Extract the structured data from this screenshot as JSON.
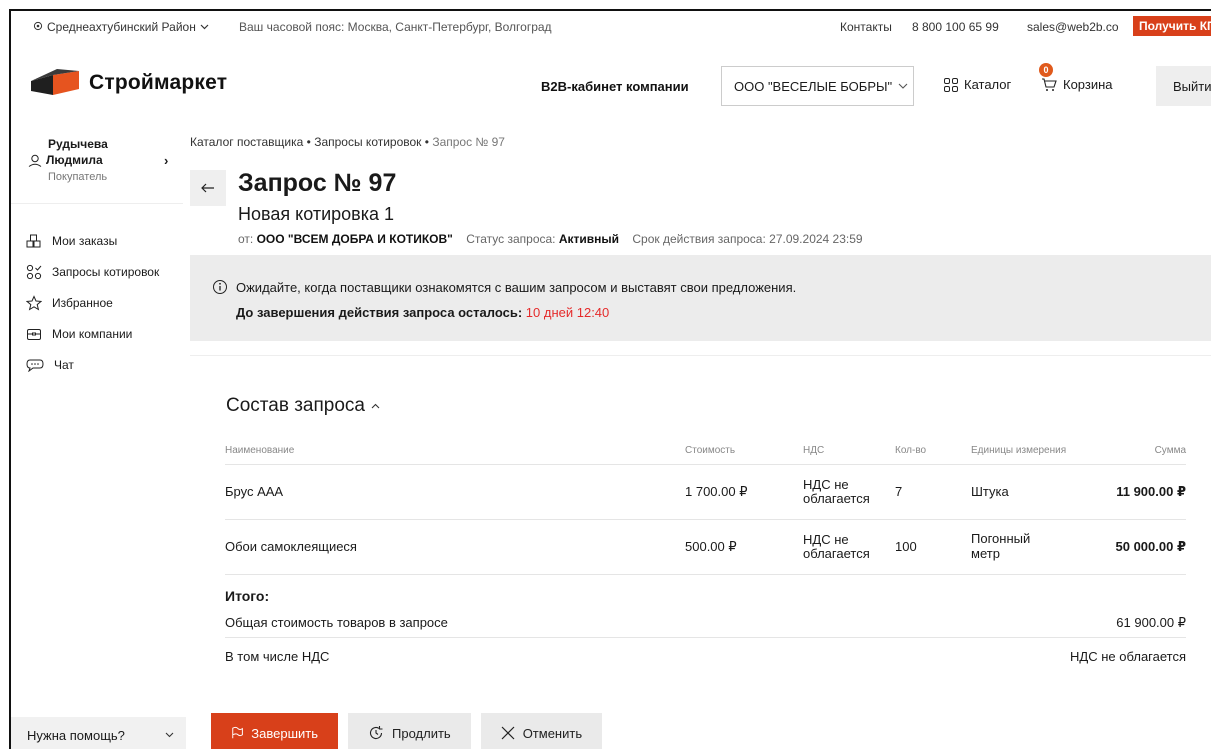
{
  "topbar": {
    "region": "Среднеахтубинский Район",
    "timezone": "Ваш часовой пояс: Москва, Санкт-Петербург, Волгоград",
    "contacts": "Контакты",
    "phone": "8 800 100 65 99",
    "email": "sales@web2b.co",
    "get_kp": "Получить КП"
  },
  "header": {
    "brand": "Строймаркет",
    "b2b_label": "B2B-кабинет компании",
    "company": "ООО \"ВЕСЕЛЫЕ БОБРЫ\"",
    "catalog": "Каталог",
    "cart": "Корзина",
    "cart_count": "0",
    "logout": "Выйти"
  },
  "sidebar": {
    "first_name": "Рудычева",
    "last_name": "Людмила",
    "role": "Покупатель",
    "items": [
      {
        "label": "Мои заказы",
        "icon": "orders-icon"
      },
      {
        "label": "Запросы котировок",
        "icon": "quotes-icon"
      },
      {
        "label": "Избранное",
        "icon": "star-icon"
      },
      {
        "label": "Мои компании",
        "icon": "briefcase-icon"
      },
      {
        "label": "Чат",
        "icon": "chat-icon"
      }
    ],
    "help": "Нужна помощь?"
  },
  "breadcrumb": {
    "items": [
      "Каталог поставщика",
      "Запросы котировок"
    ],
    "current": "Запрос № 97"
  },
  "request": {
    "title": "Запрос № 97",
    "subtitle": "Новая котировка 1",
    "from_label": "от:",
    "from_company": "ООО \"ВСЕМ ДОБРА И КОТИКОВ\"",
    "status_label": "Статус запроса:",
    "status": "Активный",
    "deadline_label": "Срок действия запроса:",
    "deadline": "27.09.2024 23:59"
  },
  "notice": {
    "line1": "Ожидайте, когда поставщики ознакомятся с вашим запросом и выставят свои предложения.",
    "line2_label": "До завершения действия запроса осталось:",
    "line2_value": "10 дней 12:40"
  },
  "composition": {
    "title": "Состав запроса",
    "headers": {
      "name": "Наименование",
      "price": "Стоимость",
      "vat": "НДС",
      "qty": "Кол-во",
      "unit": "Единицы измерения",
      "sum": "Сумма"
    },
    "rows": [
      {
        "name": "Брус ААА",
        "price": "1 700.00 ₽",
        "vat": "НДС не облагается",
        "qty": "7",
        "unit": "Штука",
        "sum": "11 900.00 ₽"
      },
      {
        "name": "Обои самоклеящиеся",
        "price": "500.00 ₽",
        "vat": "НДС не облагается",
        "qty": "100",
        "unit": "Погонный метр",
        "sum": "50 000.00 ₽"
      }
    ],
    "totals_label": "Итого:",
    "total_cost_label": "Общая стоимость товаров в запросе",
    "total_cost": "61 900.00 ₽",
    "vat_label": "В том числе НДС",
    "vat_value": "НДС не облагается"
  },
  "actions": {
    "finish": "Завершить",
    "extend": "Продлить",
    "cancel": "Отменить"
  },
  "colors": {
    "accent": "#d8401a",
    "alert": "#e52b2b"
  }
}
